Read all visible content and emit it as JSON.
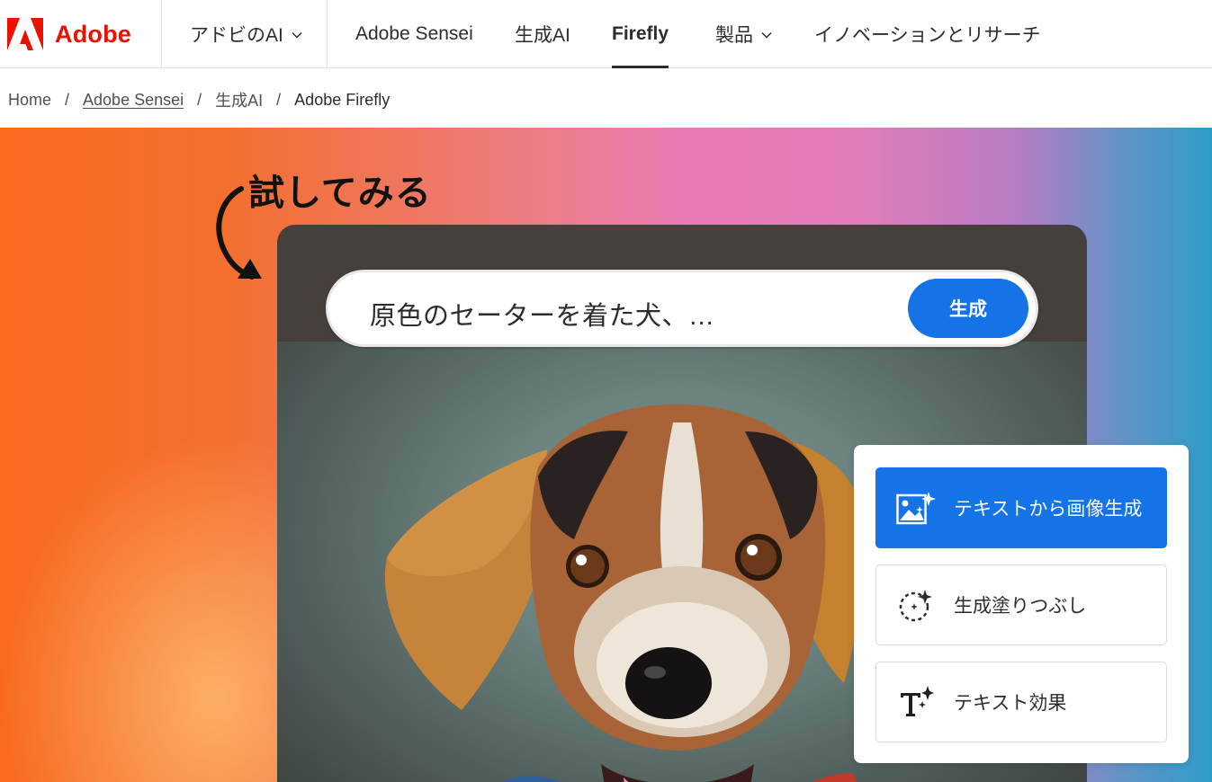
{
  "brand": {
    "name": "Adobe",
    "color": "#eb1000",
    "icon": "adobe-logo-icon"
  },
  "nav": {
    "items": [
      {
        "label": "アドビのAI",
        "dropdown": true
      },
      {
        "label": "Adobe Sensei",
        "dropdown": false
      },
      {
        "label": "生成AI",
        "dropdown": false
      },
      {
        "label": "Firefly",
        "dropdown": false,
        "active": true
      },
      {
        "label": "製品",
        "dropdown": true
      },
      {
        "label": "イノベーションとリサーチ",
        "dropdown": false
      }
    ]
  },
  "breadcrumb": {
    "separator": "/",
    "items": [
      {
        "label": "Home"
      },
      {
        "label": "Adobe Sensei",
        "link": true
      },
      {
        "label": "生成AI"
      },
      {
        "label": "Adobe Firefly",
        "current": true
      }
    ]
  },
  "hero": {
    "try_label": "試してみる",
    "prompt": {
      "text": "原色のセーターを着た犬、…",
      "button_label": "生成"
    },
    "features": [
      {
        "label": "テキストから画像生成",
        "icon": "text-to-image-icon",
        "selected": true
      },
      {
        "label": "生成塗りつぶし",
        "icon": "generative-fill-icon",
        "selected": false
      },
      {
        "label": "テキスト効果",
        "icon": "text-effects-icon",
        "selected": false
      }
    ]
  },
  "colors": {
    "accent": "#1473e6",
    "panel": "#45403c",
    "text": "#2c2c2c"
  }
}
